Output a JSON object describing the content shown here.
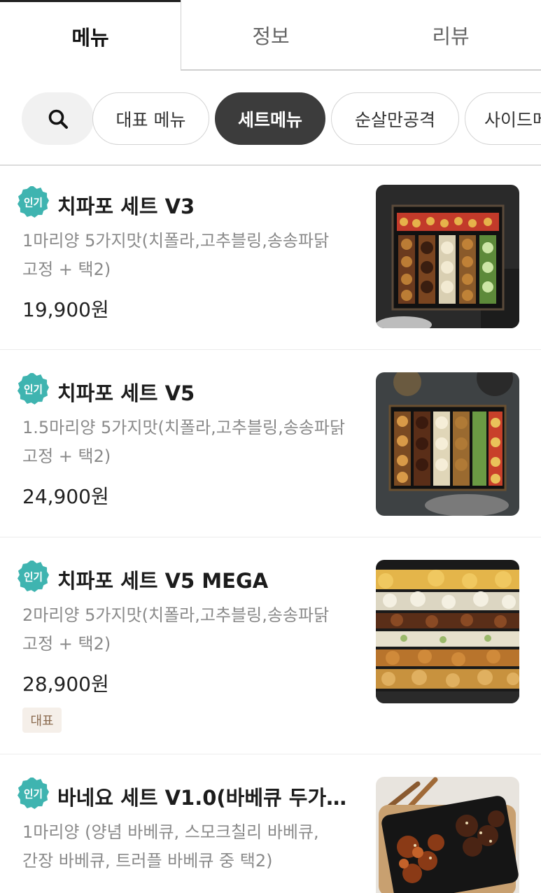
{
  "tabs": [
    {
      "label": "메뉴"
    },
    {
      "label": "정보"
    },
    {
      "label": "리뷰"
    }
  ],
  "filters": {
    "search_icon": "search-icon",
    "chips": [
      {
        "label": "대표 메뉴"
      },
      {
        "label": "세트메뉴"
      },
      {
        "label": "순살만공격"
      },
      {
        "label": "사이드메뉴"
      }
    ]
  },
  "popular_badge_label": "인기",
  "representative_tag": "대표",
  "colors": {
    "badge": "#3fb4b0",
    "active_chip": "#3c3c3c",
    "tag_bg": "#f5efe9",
    "tag_text": "#8a6a4e"
  },
  "items": [
    {
      "name": "치파포 세트 V3",
      "desc": "1마리양 5가지맛(치폴라,고추블링,송송파닭 고정 + 택2)",
      "price": "19,900원"
    },
    {
      "name": "치파포 세트 V5",
      "desc": "1.5마리양 5가지맛(치폴라,고추블링,송송파닭 고정 + 택2)",
      "price": "24,900원"
    },
    {
      "name": "치파포 세트 V5 MEGA",
      "desc": "2마리양 5가지맛(치폴라,고추블링,송송파닭 고정 + 택2)",
      "price": "28,900원"
    },
    {
      "name": "바네요 세트 V1.0(바베큐 두가…",
      "desc": "1마리양 (양념 바베큐, 스모크칠리 바베큐, 간장 바베큐, 트러플 바베큐 중 택2)",
      "price": ""
    }
  ]
}
